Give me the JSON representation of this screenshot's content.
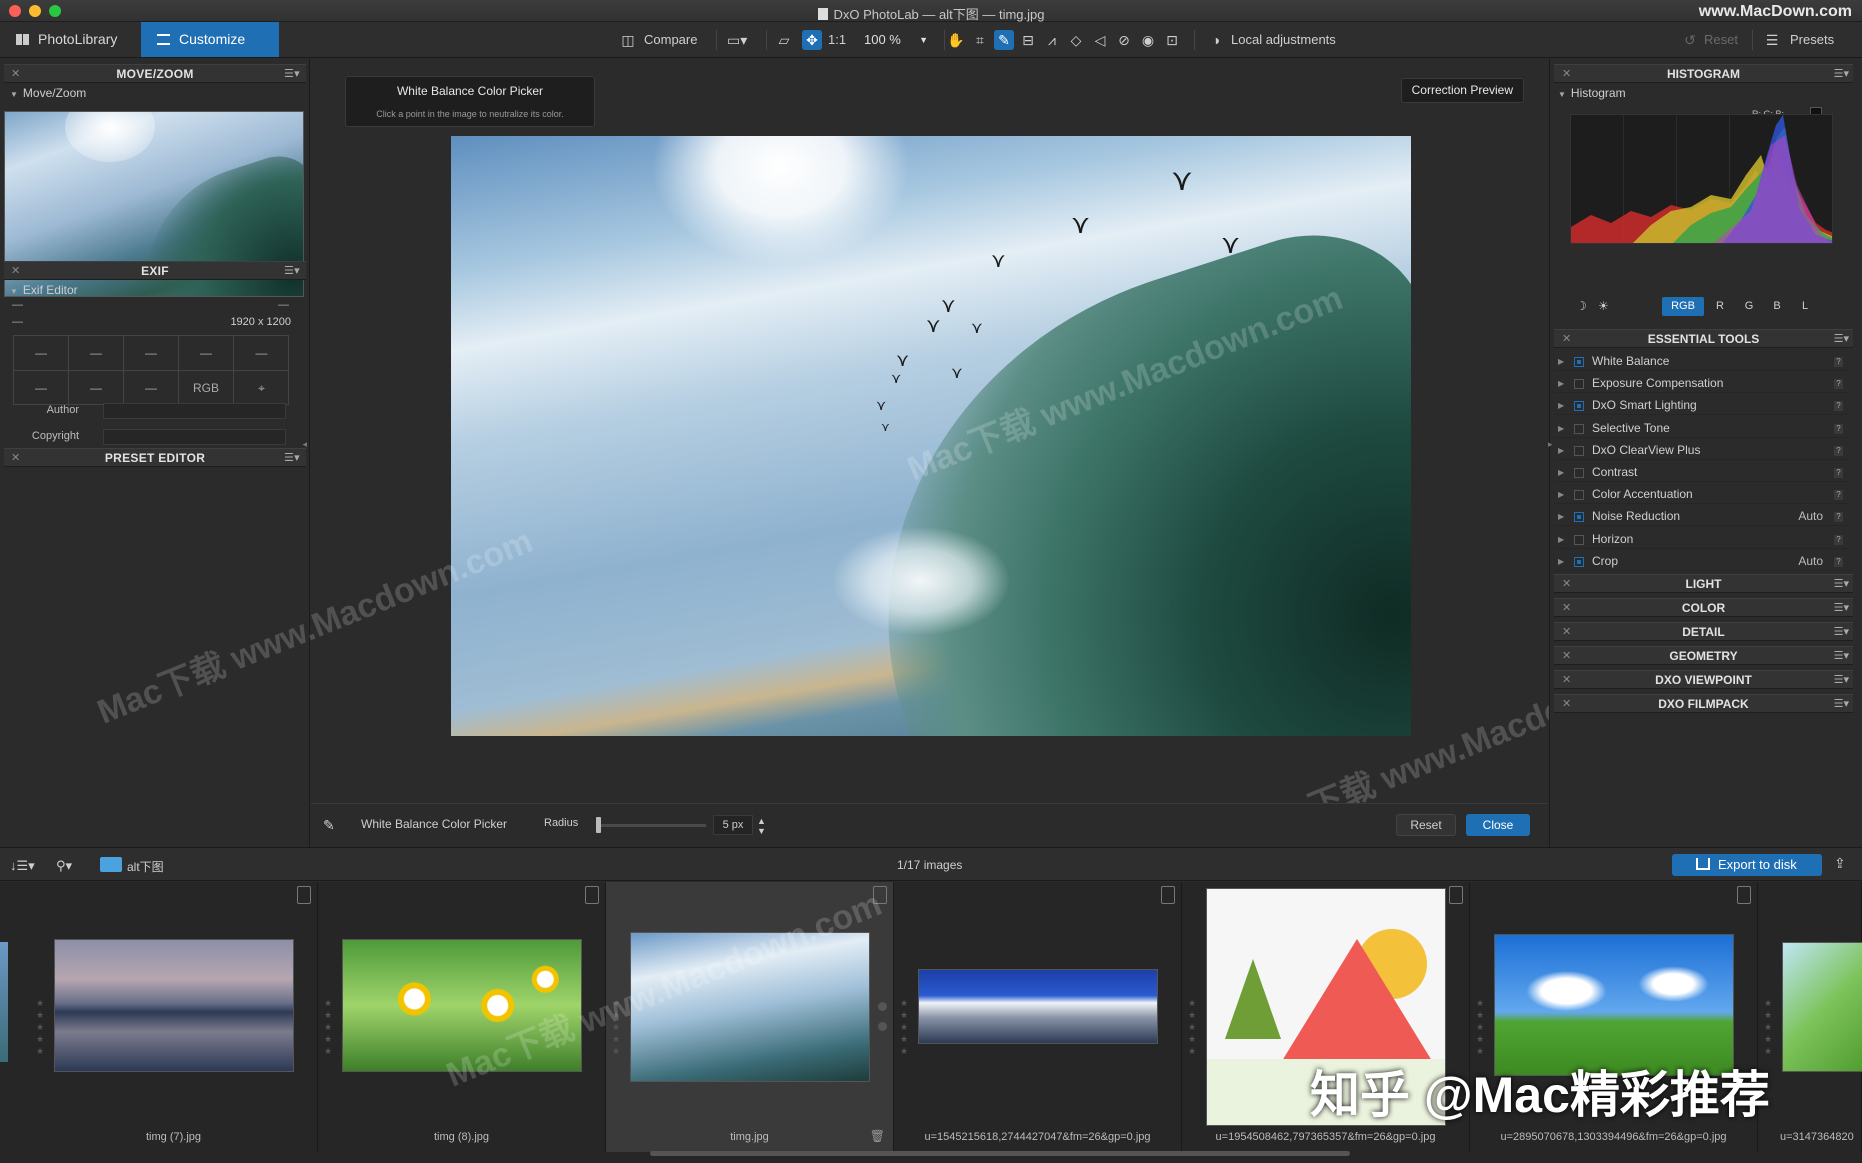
{
  "window": {
    "title": "DxO PhotoLab — alt下图 — timg.jpg",
    "watermark_url": "www.MacDown.com"
  },
  "tabs": [
    {
      "label": "PhotoLibrary"
    },
    {
      "label": "Customize"
    }
  ],
  "toolbar": {
    "compare": "Compare",
    "one_to_one": "1:1",
    "zoom": "100 %",
    "local_adjustments": "Local adjustments",
    "reset": "Reset",
    "presets": "Presets"
  },
  "left": {
    "move_zoom": {
      "title": "MOVE/ZOOM",
      "sub": "Move/Zoom"
    },
    "exif": {
      "title": "EXIF",
      "sub": "Exif Editor",
      "dims": "1920 x 1200",
      "row1": [
        "—",
        "—",
        "—",
        "—",
        "—"
      ],
      "row2": [
        "—",
        "—",
        "—",
        "RGB",
        ""
      ],
      "author_label": "Author",
      "copyright_label": "Copyright"
    },
    "preset_editor": {
      "title": "PRESET EDITOR"
    }
  },
  "center": {
    "tooltip_title": "White Balance Color Picker",
    "tooltip_sub": "Click a point in the image to neutralize its color.",
    "correction_preview": "Correction Preview",
    "bottom": {
      "tool_label": "White Balance Color Picker",
      "radius_label": "Radius",
      "radius_value": "5 px",
      "reset": "Reset",
      "close": "Close"
    }
  },
  "right": {
    "histogram": {
      "title": "HISTOGRAM",
      "sub": "Histogram",
      "channels": [
        "RGB",
        "R",
        "G",
        "B",
        "L"
      ],
      "legend": "R: G: B:"
    },
    "essential": {
      "title": "ESSENTIAL TOOLS",
      "tools": [
        {
          "name": "White Balance",
          "value": "",
          "on": true
        },
        {
          "name": "Exposure Compensation",
          "value": "",
          "on": false
        },
        {
          "name": "DxO Smart Lighting",
          "value": "",
          "on": true
        },
        {
          "name": "Selective Tone",
          "value": "",
          "on": false
        },
        {
          "name": "DxO ClearView Plus",
          "value": "",
          "on": false
        },
        {
          "name": "Contrast",
          "value": "",
          "on": false
        },
        {
          "name": "Color Accentuation",
          "value": "",
          "on": false
        },
        {
          "name": "Noise Reduction",
          "value": "Auto",
          "on": true
        },
        {
          "name": "Horizon",
          "value": "",
          "on": false
        },
        {
          "name": "Crop",
          "value": "Auto",
          "on": true
        }
      ]
    },
    "palettes": [
      "LIGHT",
      "COLOR",
      "DETAIL",
      "GEOMETRY",
      "DXO VIEWPOINT",
      "DXO FILMPACK"
    ]
  },
  "filmstrip": {
    "folder": "alt下图",
    "count": "1/17 images",
    "export": "Export to disk",
    "items": [
      {
        "name": "timg (7).jpg"
      },
      {
        "name": "timg (8).jpg"
      },
      {
        "name": "timg.jpg"
      },
      {
        "name": "u=1545215618,2744427047&fm=26&gp=0.jpg"
      },
      {
        "name": "u=1954508462,797365357&fm=26&gp=0.jpg"
      },
      {
        "name": "u=2895070678,1303394496&fm=26&gp=0.jpg"
      },
      {
        "name": "u=3147364820"
      }
    ]
  },
  "overlay_text": "知乎 @Mac精彩推荐",
  "watermark_text": "Mac下载 www.Macdown.com",
  "colors": {
    "accent": "#1f6fb5",
    "panel": "#2b2b2b"
  }
}
